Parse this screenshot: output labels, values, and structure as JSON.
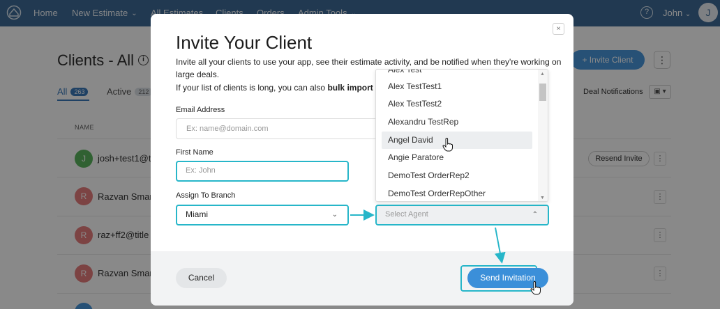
{
  "nav": {
    "items": [
      {
        "label": "Home"
      },
      {
        "label": "New Estimate",
        "chevron": true
      },
      {
        "label": "All Estimates"
      },
      {
        "label": "Clients"
      },
      {
        "label": "Orders"
      },
      {
        "label": "Admin Tools",
        "chevron": true
      }
    ],
    "help": "?",
    "user_name": "John",
    "avatar_letter": "J"
  },
  "page": {
    "title": "Clients - All",
    "info": "i",
    "invite_button": "+ Invite Client",
    "tabs": [
      {
        "label": "All",
        "count": "263"
      },
      {
        "label": "Active",
        "count": "212"
      }
    ],
    "deal_notifications": "Deal Notifications",
    "column_header": "NAME",
    "rows": [
      {
        "initial": "J",
        "name": "josh+test1@t",
        "color": "#4caf50"
      },
      {
        "initial": "R",
        "name": "Razvan Smara",
        "color": "#e57373"
      },
      {
        "initial": "R",
        "name": "raz+ff2@title",
        "color": "#e57373"
      },
      {
        "initial": "R",
        "name": "Razvan Smara",
        "color": "#e57373"
      }
    ],
    "resend_invite": "Resend Invite"
  },
  "modal": {
    "title": "Invite Your Client",
    "desc_line1": "Invite all your clients to use your app, see their estimate activity, and be notified when they're working on",
    "desc_line2": "large deals.",
    "desc_line3_prefix": "If your list of clients is long, you can also ",
    "desc_line3_bold": "bulk import you",
    "email_label": "Email Address",
    "email_placeholder": "Ex: name@domain.com",
    "first_name_label": "First Name",
    "first_name_placeholder": "Ex: John",
    "branch_label": "Assign To Branch",
    "branch_value": "Miami",
    "agent_placeholder": "Select Agent",
    "cancel": "Cancel",
    "send": "Send Invitation",
    "close": "×"
  },
  "agent_dropdown": {
    "items": [
      "Alex Test",
      "Alex TestTest1",
      "Alex TestTest2",
      "Alexandru TestRep",
      "Angel David",
      "Angie Paratore",
      "DemoTest OrderRep2",
      "DemoTest OrderRepOther"
    ],
    "hovered": "Angel David"
  },
  "colors": {
    "nav_bg": "#2f5f8f",
    "primary": "#3b8fd9",
    "highlight": "#27b6c9"
  }
}
